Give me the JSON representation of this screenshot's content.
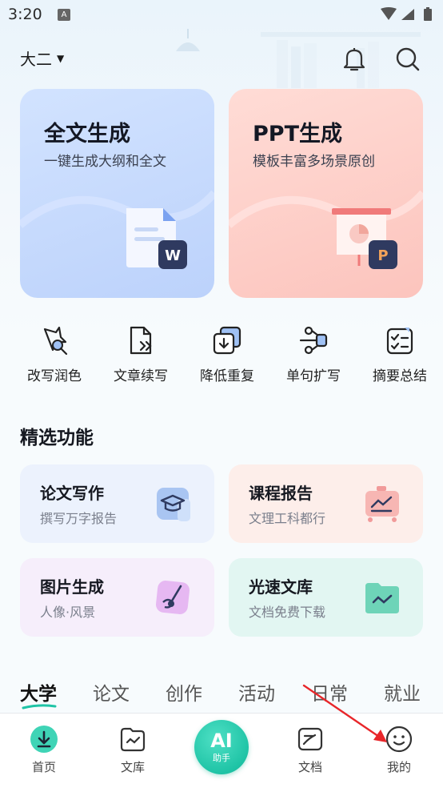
{
  "status_bar": {
    "time": "3:20",
    "notification_badge": "A"
  },
  "header": {
    "grade": "大二"
  },
  "big_cards": [
    {
      "title": "全文生成",
      "subtitle": "一键生成大纲和全文",
      "badge_icon": "word-doc-icon",
      "color": "#c6daff"
    },
    {
      "title": "PPT生成",
      "subtitle": "模板丰富多场景原创",
      "badge_icon": "ppt-icon",
      "color": "#ffd0ca"
    }
  ],
  "tools": [
    {
      "label": "改写润色",
      "icon": "magic-star-icon"
    },
    {
      "label": "文章续写",
      "icon": "continue-writing-icon"
    },
    {
      "label": "降低重复",
      "icon": "reduce-duplicate-icon"
    },
    {
      "label": "单句扩写",
      "icon": "expand-sentence-icon"
    },
    {
      "label": "摘要总结",
      "icon": "summary-icon"
    }
  ],
  "section_title": "精选功能",
  "features": [
    {
      "title": "论文写作",
      "subtitle": "撰写万字报告",
      "icon": "graduation-cap-icon"
    },
    {
      "title": "课程报告",
      "subtitle": "文理工科都行",
      "icon": "presentation-chart-icon"
    },
    {
      "title": "图片生成",
      "subtitle": "人像·风景",
      "icon": "paint-brush-icon"
    },
    {
      "title": "光速文库",
      "subtitle": "文档免费下载",
      "icon": "library-folder-icon"
    }
  ],
  "tabs": [
    "大学",
    "论文",
    "创作",
    "活动",
    "日常",
    "就业"
  ],
  "bottom_nav": {
    "home": "首页",
    "library": "文库",
    "ai_main": "AI",
    "ai_sub": "助手",
    "docs": "文档",
    "mine": "我的"
  },
  "colors": {
    "accent": "#1fc4a6",
    "annotation_arrow": "#e8262a"
  }
}
